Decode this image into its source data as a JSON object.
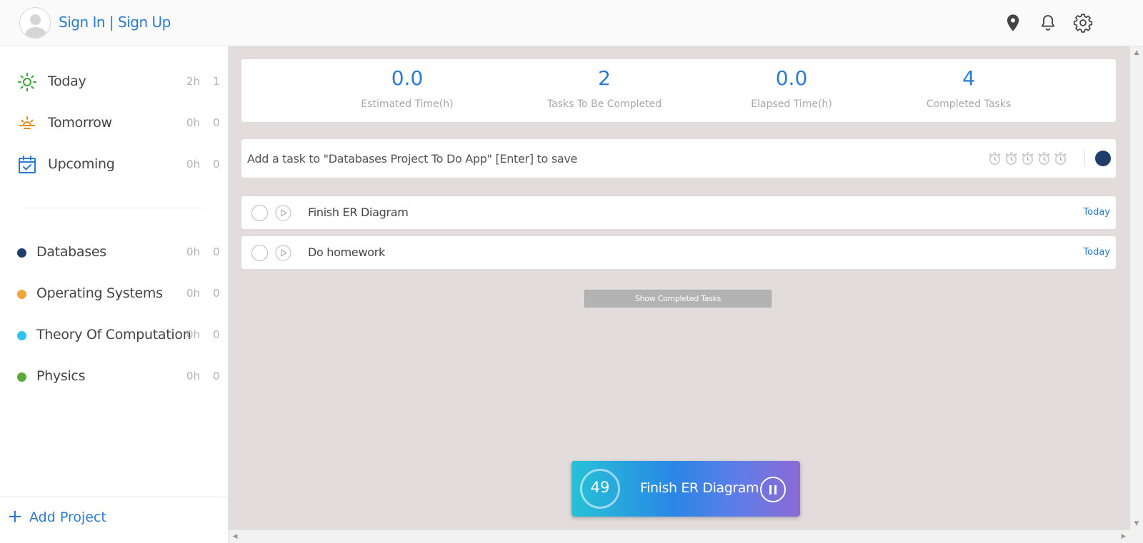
{
  "header": {
    "auth_label": "Sign In | Sign Up",
    "icons": [
      "location-pin-icon",
      "bell-icon",
      "gear-icon"
    ]
  },
  "sidebar": {
    "smart_lists": [
      {
        "label": "Today",
        "hours": "2h",
        "count": "1",
        "icon": "sun-icon",
        "color": "#3aa43a"
      },
      {
        "label": "Tomorrow",
        "hours": "0h",
        "count": "0",
        "icon": "sunrise-icon",
        "color": "#e68a1c"
      },
      {
        "label": "Upcoming",
        "hours": "0h",
        "count": "0",
        "icon": "calendar-check-icon",
        "color": "#2a7bd6"
      }
    ],
    "projects": [
      {
        "label": "Databases",
        "hours": "0h",
        "count": "0",
        "color": "#1f3c6b"
      },
      {
        "label": "Operating Systems",
        "hours": "0h",
        "count": "0",
        "color": "#f0a63a"
      },
      {
        "label": "Theory Of Computation",
        "hours": "0h",
        "count": "0",
        "color": "#2ec3f0"
      },
      {
        "label": "Physics",
        "hours": "0h",
        "count": "0",
        "color": "#5caa3c"
      }
    ],
    "add_project_label": "Add Project"
  },
  "stats": [
    {
      "value": "0.0",
      "label": "Estimated Time(h)"
    },
    {
      "value": "2",
      "label": "Tasks To Be Completed"
    },
    {
      "value": "0.0",
      "label": "Elapsed Time(h)"
    },
    {
      "value": "4",
      "label": "Completed Tasks"
    }
  ],
  "add_task": {
    "placeholder": "Add a task to \"Databases Project To Do App\" [Enter] to save",
    "pomodoro_icons": [
      "timer-icon",
      "timer-icon",
      "timer-icon",
      "timer-icon",
      "timer-icon"
    ],
    "project_color": "#1f3c6b"
  },
  "tasks": [
    {
      "title": "Finish ER Diagram",
      "due": "Today"
    },
    {
      "title": "Do homework",
      "due": "Today"
    }
  ],
  "show_completed_label": "Show Completed Tasks",
  "active_timer": {
    "minutes": "49",
    "task": "Finish ER Diagram"
  }
}
